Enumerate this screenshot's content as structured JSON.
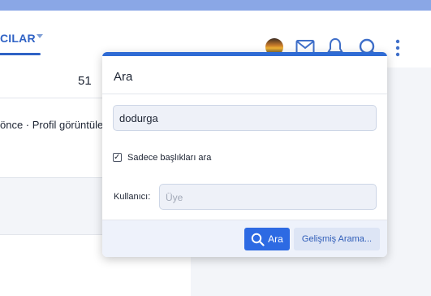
{
  "nav": {
    "active_tab_label": "CILAR"
  },
  "header": {
    "icons": [
      "avatar",
      "envelope-icon",
      "bell-icon",
      "search-icon",
      "more-vertical-icon"
    ]
  },
  "content": {
    "count": "51",
    "meta": "önce · Profil görüntüle"
  },
  "search_popup": {
    "title": "Ara",
    "query_value": "dodurga",
    "titles_only_checked": true,
    "titles_only_label": "Sadece başlıkları ara",
    "user_label": "Kullanıcı:",
    "user_placeholder": "Üye",
    "search_button_label": "Ara",
    "advanced_button_label": "Gelişmiş Arama..."
  },
  "colors": {
    "accent": "#2f6bd4",
    "primary_button": "#2d6ae3",
    "top_bar": "#8aa7e6"
  }
}
